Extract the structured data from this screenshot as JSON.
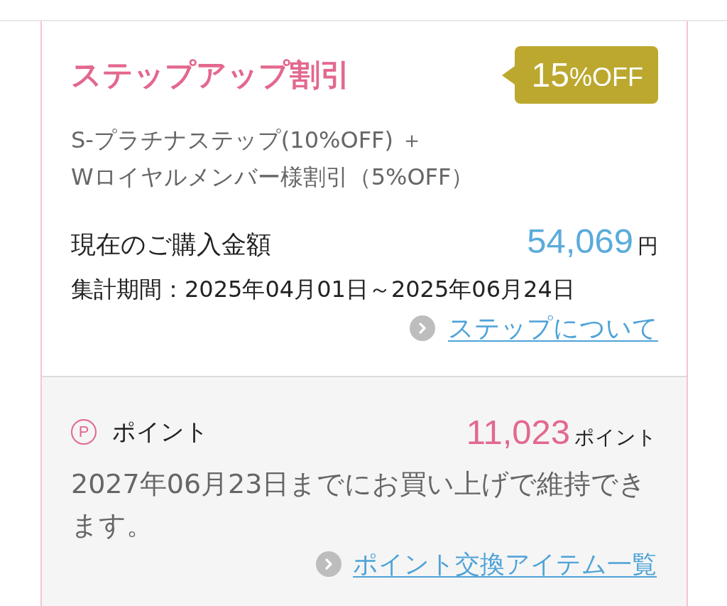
{
  "step_discount": {
    "title": "ステップアップ割引",
    "badge": {
      "value": "15",
      "unit": "%OFF"
    },
    "details": [
      "S-プラチナステップ(10%OFF) ＋",
      "Wロイヤルメンバー様割引（5%OFF）"
    ],
    "purchase": {
      "label": "現在のご購入金額",
      "amount": "54,069",
      "unit": "円"
    },
    "period": "集計期間：2025年04月01日～2025年06月24日",
    "link": "ステップについて"
  },
  "points": {
    "icon": "P",
    "label": "ポイント",
    "amount": "11,023",
    "unit": "ポイント",
    "note": "2027年06月23日までにお買い上げで維持できます。",
    "link": "ポイント交換アイテム一覧"
  }
}
